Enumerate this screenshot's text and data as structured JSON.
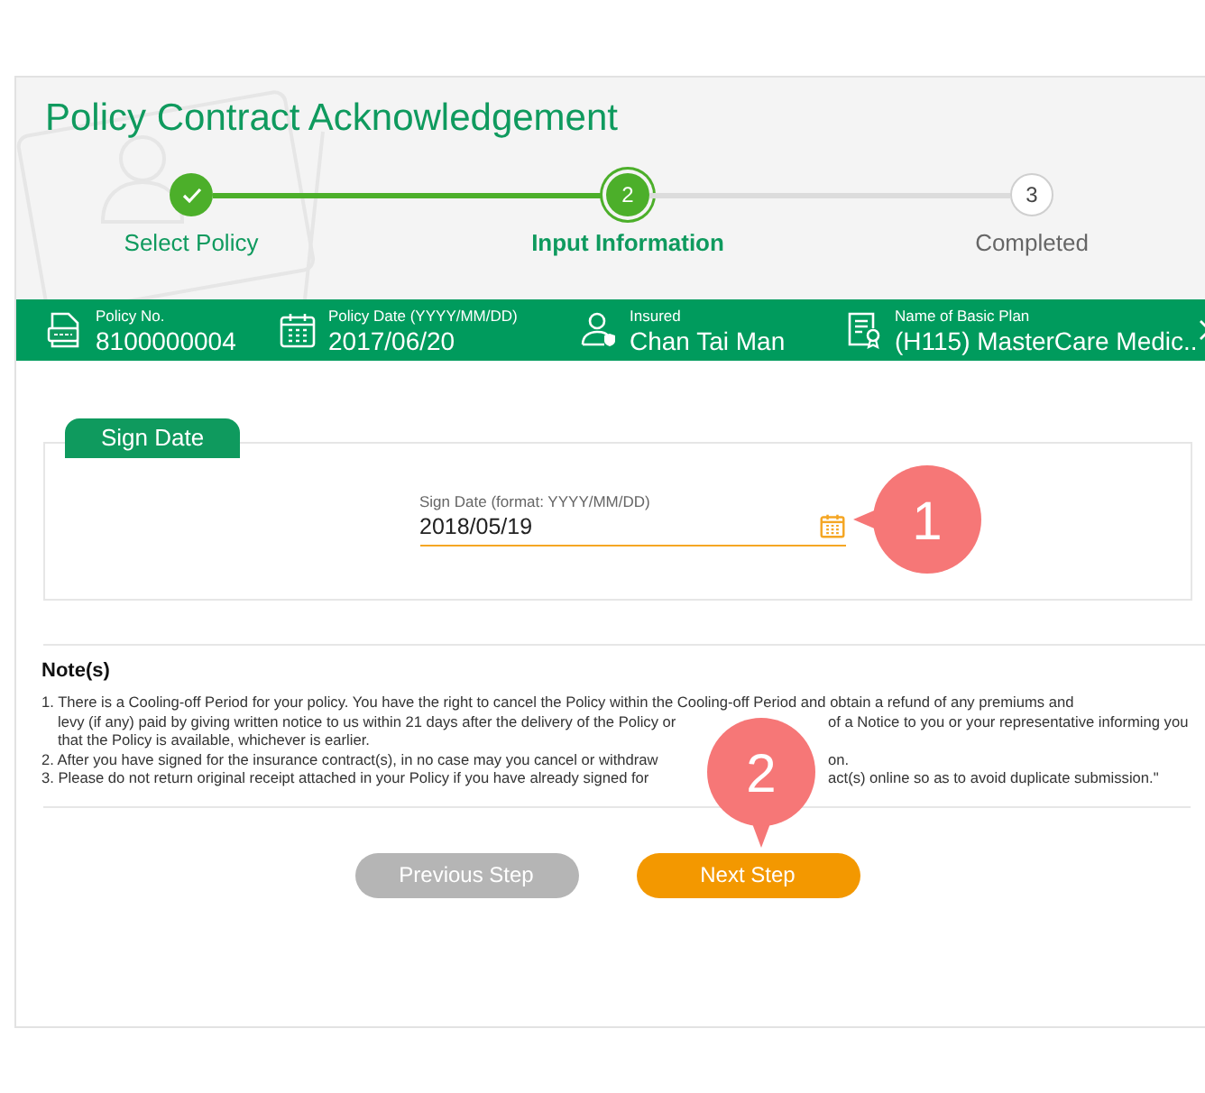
{
  "title": "Policy Contract Acknowledgement",
  "steps": [
    {
      "label": "Select Policy",
      "completed": true,
      "selected": false
    },
    {
      "label": "Input Information",
      "completed": false,
      "selected": true,
      "number": "2"
    },
    {
      "label": "Completed",
      "completed": false,
      "selected": false,
      "number": "3"
    }
  ],
  "info_bar": {
    "items": [
      {
        "kind": "document",
        "label": "Policy No.",
        "value": "8100000004"
      },
      {
        "kind": "calendar",
        "label": "Policy Date (YYYY/MM/DD)",
        "value": "2017/06/20"
      },
      {
        "kind": "person",
        "label": "Insured",
        "value": "Chan Tai Man"
      },
      {
        "kind": "certificate",
        "label": "Name of Basic Plan",
        "value": "(H115) MasterCare Medic.."
      }
    ]
  },
  "sign_date": {
    "tab": "Sign Date",
    "field": {
      "label": "Sign Date (format: YYYY/MM/DD)",
      "value": "2018/05/19"
    },
    "callout": "1"
  },
  "notes": {
    "heading": "Note(s)",
    "callout": "2",
    "items": [
      {
        "lines": [
          {
            "parts": [
              "1. There is a Cooling-off Period for your policy. You have the right to cancel the Policy within the Cooling-off Period and obtain a refund of any premiums and"
            ]
          },
          {
            "parts": [
              "levy (if any) paid by giving written notice to us within 21 days after the delivery of the Policy or",
              "of a Notice to you or your representative informing you"
            ]
          },
          {
            "parts": [
              "that the Policy is available, whichever is earlier."
            ]
          }
        ]
      },
      {
        "lines": [
          {
            "parts": [
              "2. After you have signed for the insurance contract(s), in no case may you cancel or withdraw",
              "on."
            ]
          }
        ]
      },
      {
        "lines": [
          {
            "parts": [
              "3. Please do not return original receipt attached in your Policy if you have already signed for",
              "act(s) online so as to avoid duplicate submission.\""
            ]
          }
        ]
      }
    ]
  },
  "buttons": [
    {
      "label": "Previous Step",
      "disabled": true
    },
    {
      "label": "Next Step",
      "disabled": false
    }
  ]
}
